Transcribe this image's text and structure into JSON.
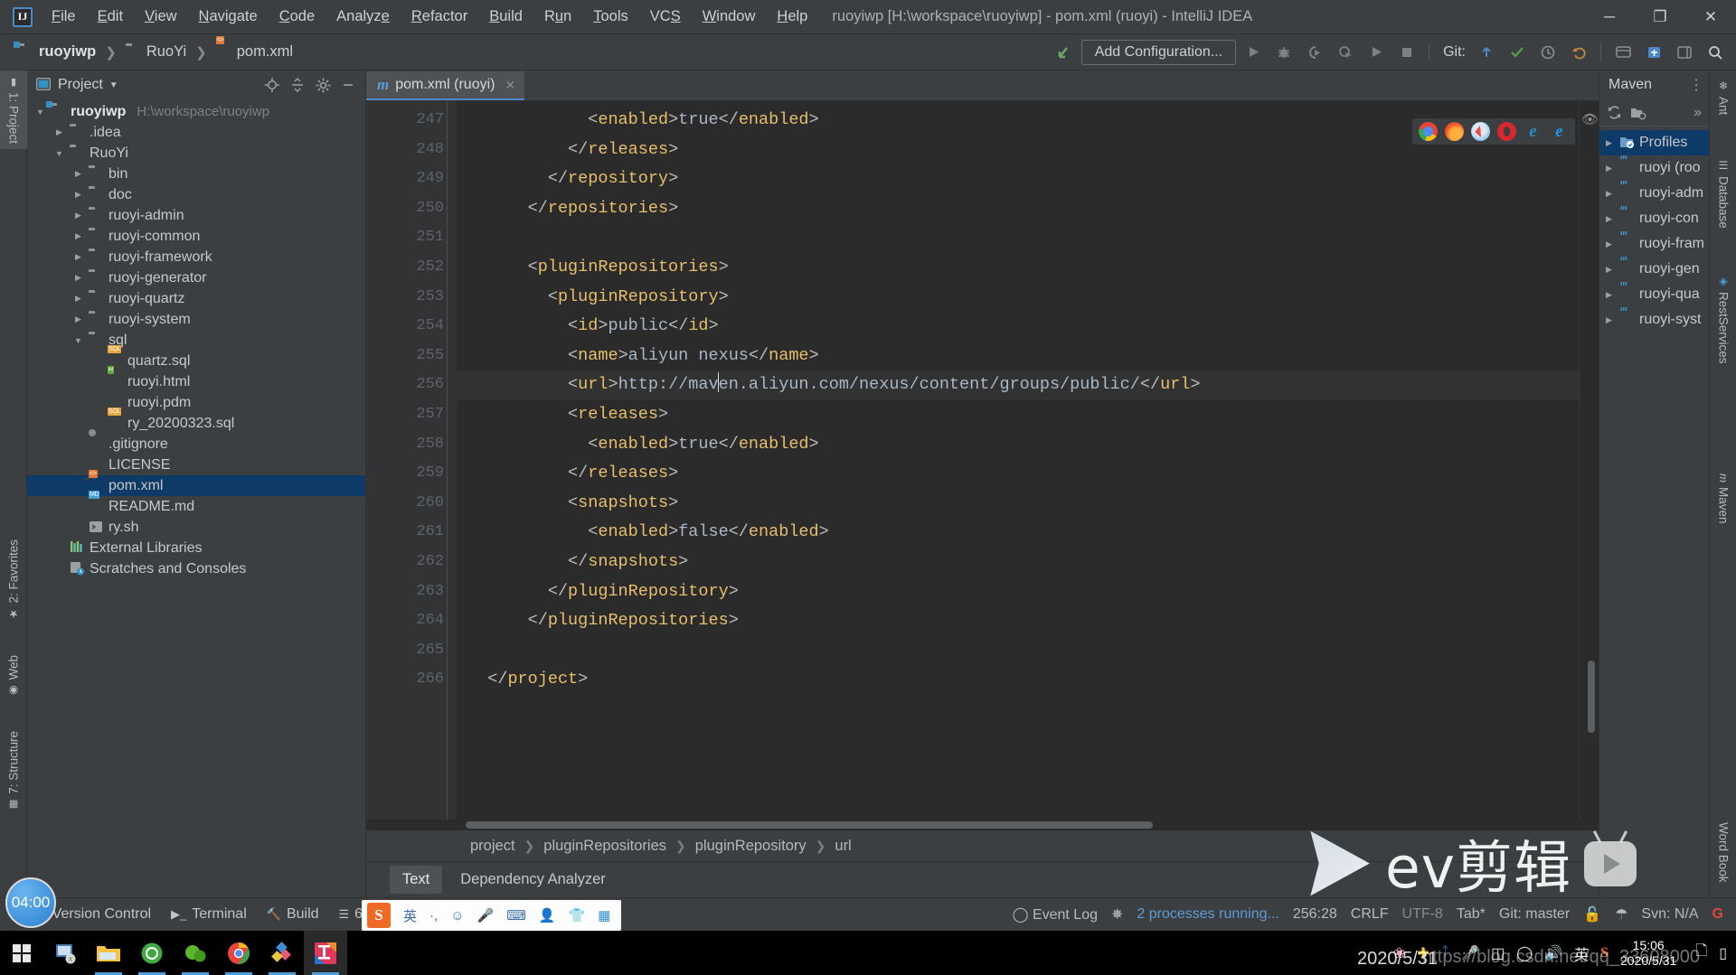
{
  "window": {
    "title": "ruoyiwp [H:\\workspace\\ruoyiwp] - pom.xml (ruoyi) - IntelliJ IDEA",
    "logo": "IJ",
    "minimize": "─",
    "maximize": "❐",
    "close": "✕"
  },
  "menu": [
    {
      "label": "File"
    },
    {
      "label": "Edit"
    },
    {
      "label": "View"
    },
    {
      "label": "Navigate"
    },
    {
      "label": "Code"
    },
    {
      "label": "Analyze"
    },
    {
      "label": "Refactor"
    },
    {
      "label": "Build"
    },
    {
      "label": "Run"
    },
    {
      "label": "Tools"
    },
    {
      "label": "VCS"
    },
    {
      "label": "Window"
    },
    {
      "label": "Help"
    }
  ],
  "navbar": {
    "crumbs": [
      {
        "label": "ruoyiwp",
        "icon": "module-folder-icon"
      },
      {
        "label": "RuoYi",
        "icon": "folder-icon"
      },
      {
        "label": "pom.xml",
        "icon": "xml-file-icon"
      }
    ],
    "add_configuration": "Add Configuration...",
    "git_label": "Git:"
  },
  "left_strip": {
    "project_tab": "1: Project",
    "favorites_tab": "2: Favorites",
    "structure_tab": "7: Structure",
    "web_tab": "Web"
  },
  "project_panel": {
    "title": "Project",
    "tree": [
      {
        "depth": 0,
        "label": "ruoyiwp",
        "path": "H:\\workspace\\ruoyiwp",
        "icon": "module-folder-icon",
        "arrow": "down",
        "bold": true
      },
      {
        "depth": 1,
        "label": ".idea",
        "icon": "folder-icon",
        "arrow": "right"
      },
      {
        "depth": 1,
        "label": "RuoYi",
        "icon": "folder-icon",
        "arrow": "down"
      },
      {
        "depth": 2,
        "label": "bin",
        "icon": "folder-icon",
        "arrow": "right"
      },
      {
        "depth": 2,
        "label": "doc",
        "icon": "folder-icon",
        "arrow": "right"
      },
      {
        "depth": 2,
        "label": "ruoyi-admin",
        "icon": "folder-icon",
        "arrow": "right"
      },
      {
        "depth": 2,
        "label": "ruoyi-common",
        "icon": "folder-icon",
        "arrow": "right"
      },
      {
        "depth": 2,
        "label": "ruoyi-framework",
        "icon": "folder-icon",
        "arrow": "right"
      },
      {
        "depth": 2,
        "label": "ruoyi-generator",
        "icon": "folder-icon",
        "arrow": "right"
      },
      {
        "depth": 2,
        "label": "ruoyi-quartz",
        "icon": "folder-icon",
        "arrow": "right"
      },
      {
        "depth": 2,
        "label": "ruoyi-system",
        "icon": "folder-icon",
        "arrow": "right"
      },
      {
        "depth": 2,
        "label": "sql",
        "icon": "folder-icon",
        "arrow": "down"
      },
      {
        "depth": 3,
        "label": "quartz.sql",
        "icon": "sql-file-icon",
        "arrow": "none"
      },
      {
        "depth": 3,
        "label": "ruoyi.html",
        "icon": "html-file-icon",
        "arrow": "none"
      },
      {
        "depth": 3,
        "label": "ruoyi.pdm",
        "icon": "text-file-icon",
        "arrow": "none"
      },
      {
        "depth": 3,
        "label": "ry_20200323.sql",
        "icon": "sql-file-icon",
        "arrow": "none"
      },
      {
        "depth": 2,
        "label": ".gitignore",
        "icon": "gitignore-file-icon",
        "arrow": "none"
      },
      {
        "depth": 2,
        "label": "LICENSE",
        "icon": "text-file-icon",
        "arrow": "none"
      },
      {
        "depth": 2,
        "label": "pom.xml",
        "icon": "xml-file-icon",
        "arrow": "none",
        "selected": true
      },
      {
        "depth": 2,
        "label": "README.md",
        "icon": "md-file-icon",
        "arrow": "none"
      },
      {
        "depth": 2,
        "label": "ry.sh",
        "icon": "shell-file-icon",
        "arrow": "none"
      },
      {
        "depth": 1,
        "label": "External Libraries",
        "icon": "libraries-icon",
        "arrow": "none"
      },
      {
        "depth": 1,
        "label": "Scratches and Consoles",
        "icon": "scratches-icon",
        "arrow": "none"
      }
    ]
  },
  "editor": {
    "tab": {
      "label": "pom.xml (ruoyi)",
      "icon": "maven-m-icon",
      "close": "✕"
    },
    "browsers": [
      "chrome-icon",
      "firefox-icon",
      "safari-icon",
      "opera-icon",
      "ie-icon",
      "edge-icon"
    ],
    "first_line_number": 247,
    "lines": [
      {
        "n": 247,
        "indent": 12,
        "fold": false,
        "html": "&lt;<span class='tag'>enabled</span>&gt;<span class='txt'>true</span>&lt;/<span class='tag'>enabled</span>&gt;"
      },
      {
        "n": 248,
        "indent": 10,
        "fold": true,
        "html": "&lt;/<span class='tag'>releases</span>&gt;"
      },
      {
        "n": 249,
        "indent": 8,
        "fold": true,
        "html": "&lt;/<span class='tag'>repository</span>&gt;"
      },
      {
        "n": 250,
        "indent": 6,
        "fold": true,
        "html": "&lt;/<span class='tag'>repositories</span>&gt;"
      },
      {
        "n": 251,
        "indent": 0,
        "fold": false,
        "html": ""
      },
      {
        "n": 252,
        "indent": 6,
        "fold": true,
        "html": "&lt;<span class='tag'>pluginRepositories</span>&gt;"
      },
      {
        "n": 253,
        "indent": 8,
        "fold": true,
        "html": "&lt;<span class='tag'>pluginRepository</span>&gt;"
      },
      {
        "n": 254,
        "indent": 10,
        "fold": false,
        "html": "&lt;<span class='tag'>id</span>&gt;<span class='txt'>public</span>&lt;/<span class='tag'>id</span>&gt;"
      },
      {
        "n": 255,
        "indent": 10,
        "fold": false,
        "html": "&lt;<span class='tag'>name</span>&gt;<span class='txt'>aliyun nexus</span>&lt;/<span class='tag'>name</span>&gt;"
      },
      {
        "n": 256,
        "indent": 10,
        "fold": false,
        "highlight": true,
        "html": "&lt;<span class='tag'>url</span>&gt;<span class='txt'>http://mav<span class='caret'></span>en.aliyun.com/nexus/content/groups/public/</span>&lt;/<span class='tag'>url</span>&gt;"
      },
      {
        "n": 257,
        "indent": 10,
        "fold": true,
        "html": "&lt;<span class='tag'>releases</span>&gt;"
      },
      {
        "n": 258,
        "indent": 12,
        "fold": false,
        "html": "&lt;<span class='tag'>enabled</span>&gt;<span class='txt'>true</span>&lt;/<span class='tag'>enabled</span>&gt;"
      },
      {
        "n": 259,
        "indent": 10,
        "fold": true,
        "html": "&lt;/<span class='tag'>releases</span>&gt;"
      },
      {
        "n": 260,
        "indent": 10,
        "fold": true,
        "html": "&lt;<span class='tag'>snapshots</span>&gt;"
      },
      {
        "n": 261,
        "indent": 12,
        "fold": false,
        "html": "&lt;<span class='tag'>enabled</span>&gt;<span class='txt'>false</span>&lt;/<span class='tag'>enabled</span>&gt;"
      },
      {
        "n": 262,
        "indent": 10,
        "fold": true,
        "html": "&lt;/<span class='tag'>snapshots</span>&gt;"
      },
      {
        "n": 263,
        "indent": 8,
        "fold": true,
        "html": "&lt;/<span class='tag'>pluginRepository</span>&gt;"
      },
      {
        "n": 264,
        "indent": 6,
        "fold": true,
        "html": "&lt;/<span class='tag'>pluginRepositories</span>&gt;"
      },
      {
        "n": 265,
        "indent": 0,
        "fold": false,
        "html": ""
      },
      {
        "n": 266,
        "indent": 2,
        "fold": true,
        "html": "&lt;/<span class='tag'>project</span>&gt;"
      }
    ],
    "breadcrumbs": [
      "project",
      "pluginRepositories",
      "pluginRepository",
      "url"
    ],
    "bottom_tabs": [
      {
        "label": "Text",
        "active": true
      },
      {
        "label": "Dependency Analyzer",
        "active": false
      }
    ]
  },
  "maven_panel": {
    "title": "Maven",
    "tree": [
      {
        "label": "Profiles",
        "icon": "profiles-icon",
        "selected": true
      },
      {
        "label": "ruoyi (roo",
        "icon": "maven-module-icon"
      },
      {
        "label": "ruoyi-adm",
        "icon": "maven-module-icon"
      },
      {
        "label": "ruoyi-con",
        "icon": "maven-module-icon"
      },
      {
        "label": "ruoyi-fram",
        "icon": "maven-module-icon"
      },
      {
        "label": "ruoyi-gen",
        "icon": "maven-module-icon"
      },
      {
        "label": "ruoyi-qua",
        "icon": "maven-module-icon"
      },
      {
        "label": "ruoyi-syst",
        "icon": "maven-module-icon"
      }
    ],
    "more": "»"
  },
  "right_strip": {
    "ant_tab": "Ant",
    "database_tab": "Database",
    "restservices_tab": "RestServices",
    "maven_tab": "Maven",
    "wordbook_tab": "Word Book"
  },
  "bottom_bar": {
    "windows": [
      {
        "label": "9: Version Control",
        "icon": "version-control-icon"
      },
      {
        "label": "Terminal",
        "icon": "terminal-icon"
      },
      {
        "label": "Build",
        "icon": "build-hammer-icon"
      },
      {
        "label": "6: TODO",
        "icon": "todo-icon"
      }
    ],
    "event_log": "Event Log",
    "status": {
      "processes": "2 processes running...",
      "caret_position": "256:28",
      "line_separator": "CRLF",
      "encoding": "UTF-8",
      "indent": "Tab*",
      "branch": "Git: master",
      "svn": "Svn: N/A"
    }
  },
  "taskbar": {
    "items": [
      {
        "icon": "windows-start-icon",
        "running": false
      },
      {
        "icon": "xshell-icon",
        "running": false
      },
      {
        "icon": "file-explorer-icon",
        "running": true
      },
      {
        "icon": "ie-green-icon",
        "running": true
      },
      {
        "icon": "navicat-icon",
        "running": true
      },
      {
        "icon": "chrome-icon",
        "running": true
      },
      {
        "icon": "sourcetree-icon",
        "running": true
      },
      {
        "icon": "intellij-idea-icon",
        "running": true,
        "active": true
      }
    ],
    "tray": [
      "flower-icon",
      "plus-circle-icon",
      "bluetooth-icon",
      "microphone-icon",
      "battery-icon",
      "wifi-icon",
      "volume-icon",
      "ime-cn-icon",
      "sogou-icon"
    ],
    "clock_time": "15:06",
    "clock_date": "2020/5/31"
  },
  "overlays": {
    "timer": "04:00",
    "ime": {
      "logo": "S",
      "items": [
        "英",
        "·,",
        "☺",
        "🎤",
        "⌨",
        "👤",
        "👕",
        "▣"
      ]
    },
    "watermark_ev": "ev剪辑",
    "watermark_url": "https://blog.csdn.net/qq_33608000",
    "watermark_date": "2020/5/31"
  }
}
